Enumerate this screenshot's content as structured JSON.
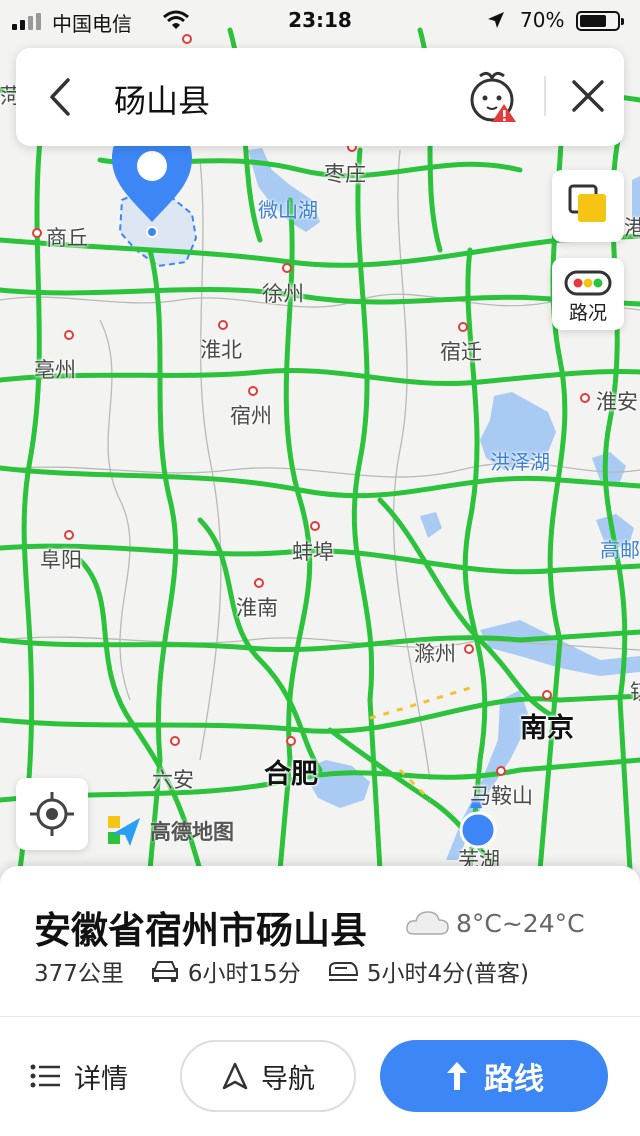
{
  "status_bar": {
    "carrier": "中国电信",
    "time": "23:18",
    "battery": "70%"
  },
  "search": {
    "query": "砀山县"
  },
  "map": {
    "cities": {
      "shangqiu": "商丘",
      "zaozhuang": "枣庄",
      "xuzhou": "徐州",
      "huaibei": "淮北",
      "suqian": "宿迁",
      "bozhou": "亳州",
      "suzhou": "宿州",
      "huaian": "淮安",
      "fuyang": "阜阳",
      "bengbu": "蚌埠",
      "huainan": "淮南",
      "chuzhou": "滁州",
      "gaoyou": "高邮",
      "nanjing": "南京",
      "luan": "六安",
      "hefei": "合肥",
      "maanshan": "马鞍山",
      "wuhu": "芜湖",
      "edge_top_left": "菏",
      "edge_right_top": "港",
      "edge_right_mid": "镇"
    },
    "lakes": {
      "weishan": "微山湖",
      "hongze": "洪泽湖"
    },
    "traffic_label": "路况",
    "brand": "高德地图"
  },
  "card": {
    "place_name": "安徽省宿州市砀山县",
    "weather": "8°C~24°C",
    "distance": "377公里",
    "drive_time": "6小时15分",
    "train_time": "5小时4分(普客)"
  },
  "actions": {
    "details": "详情",
    "navigate": "导航",
    "route": "路线"
  },
  "colors": {
    "road": "#2cc23c",
    "water": "#a9cbf3",
    "accent": "#3d86f5",
    "city_dot": "#e23b3b"
  }
}
